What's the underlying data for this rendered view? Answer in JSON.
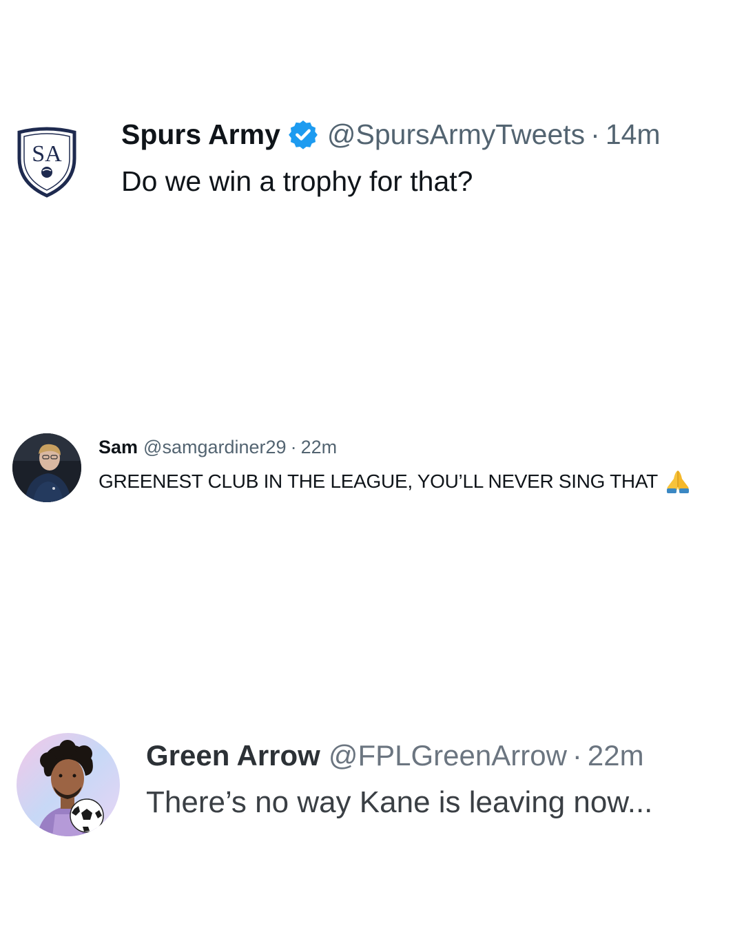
{
  "tweets": [
    {
      "display_name": "Spurs Army",
      "verified": true,
      "handle": "@SpursArmyTweets",
      "separator": "·",
      "time": "14m",
      "text": "Do we win a trophy for that?",
      "avatar": {
        "icon": "sa-shield-logo",
        "logo_text": "SA"
      }
    },
    {
      "display_name": "Sam",
      "handle": "@samgardiner29",
      "separator": "·",
      "time": "22m",
      "text": "GREENEST CLUB IN THE LEAGUE, YOU’LL NEVER SING THAT",
      "emoji": "folded-hands-icon",
      "avatar": {
        "icon": "person-photo"
      }
    },
    {
      "display_name": "Green Arrow",
      "handle": "@FPLGreenArrow",
      "separator": "·",
      "time": "22m",
      "text": "There’s no way Kane is leaving now...",
      "avatar": {
        "icon": "person-with-football-photo"
      }
    }
  ],
  "colors": {
    "verified_blue": "#1d9bf0",
    "text_primary": "#0f1419",
    "text_secondary": "#536471",
    "shield_navy": "#1e2a4f"
  }
}
